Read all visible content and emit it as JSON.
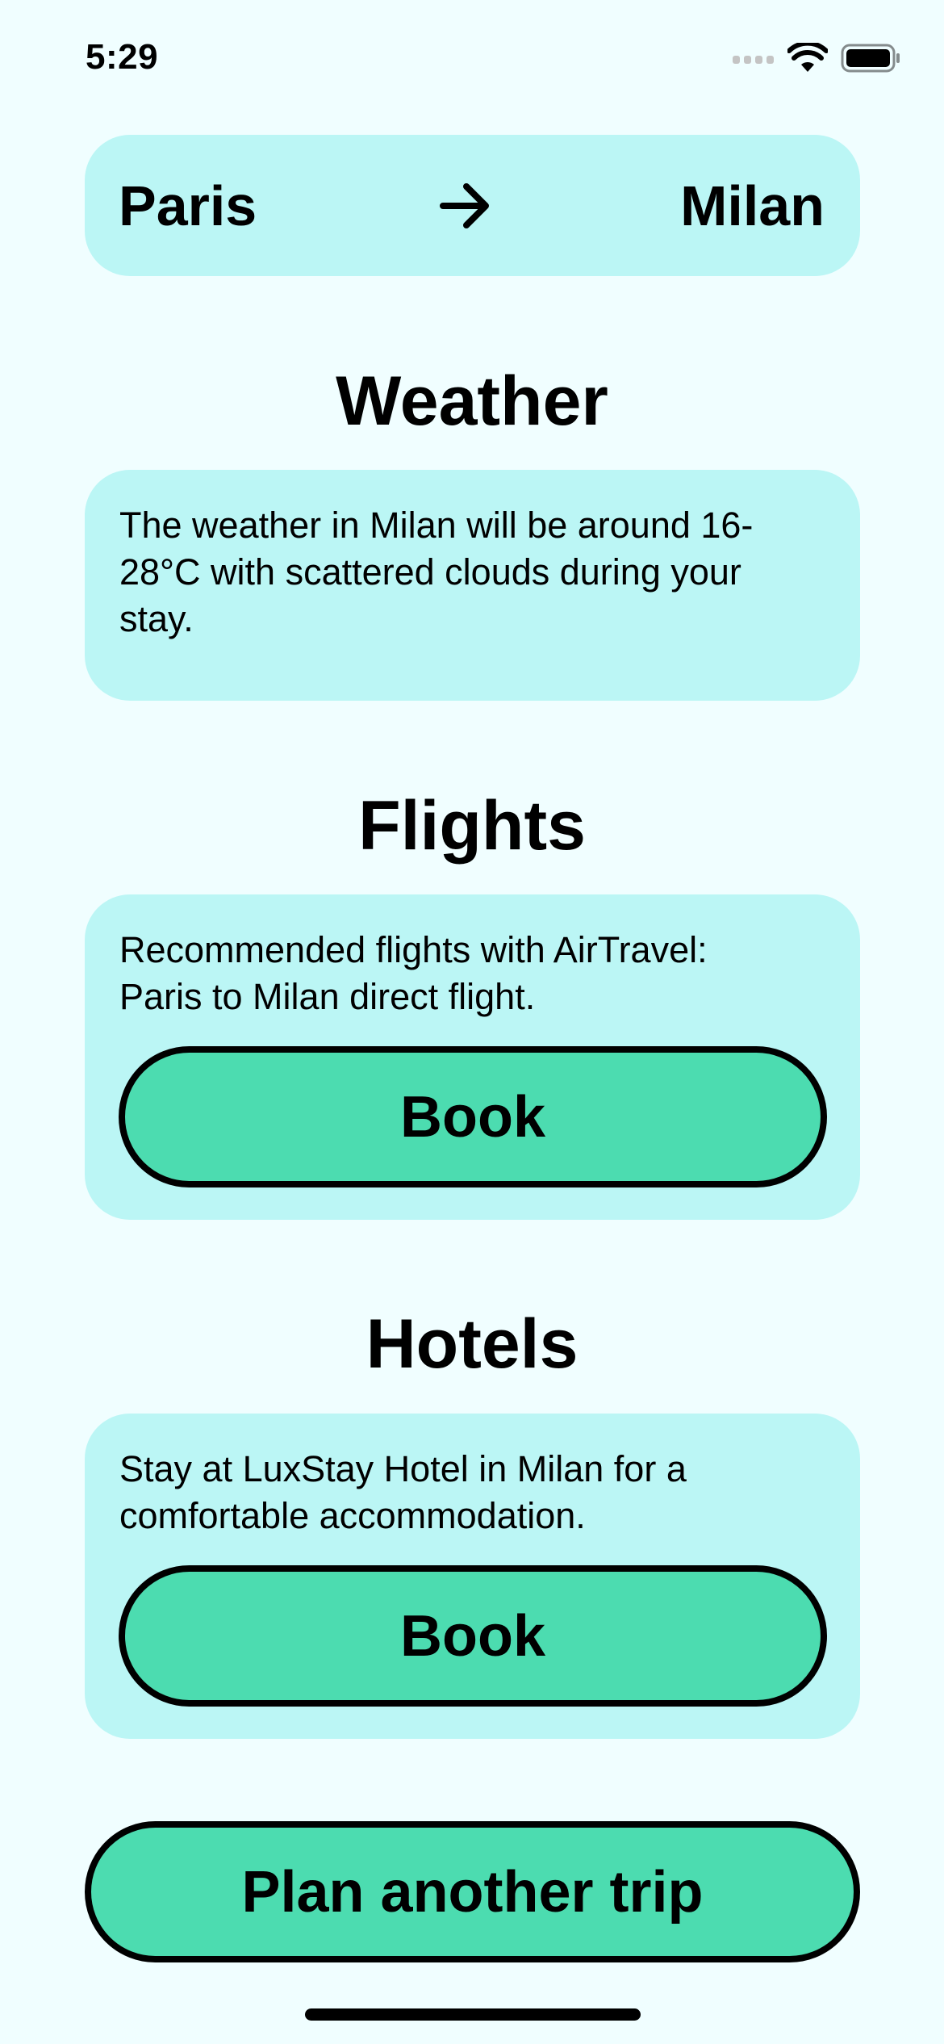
{
  "status_bar": {
    "time": "5:29",
    "icons": [
      "cellular-signal-icon",
      "wifi-icon",
      "battery-icon"
    ]
  },
  "route": {
    "from": "Paris",
    "to": "Milan",
    "arrow_icon": "arrow-right-icon"
  },
  "weather": {
    "title": "Weather",
    "description": "The weather in Milan will be around 16-28°C with scattered clouds during your stay."
  },
  "flights": {
    "title": "Flights",
    "description": "Recommended flights with AirTravel: Paris to Milan direct flight.",
    "button_label": "Book"
  },
  "hotels": {
    "title": "Hotels",
    "description": "Stay at LuxStay Hotel in Milan for a comfortable accommodation.",
    "button_label": "Book"
  },
  "plan_another_trip_label": "Plan another trip",
  "colors": {
    "background": "#f0feff",
    "card": "#bbf6f5",
    "button": "#4cdcb0",
    "text": "#000000"
  }
}
